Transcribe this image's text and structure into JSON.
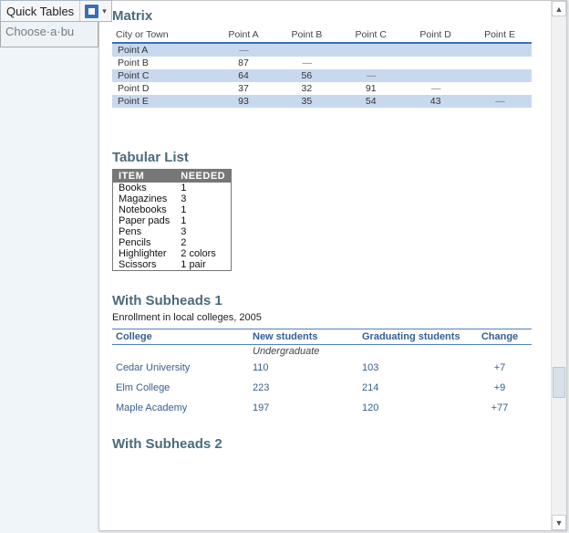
{
  "toolbar": {
    "quick_tables_label": "Quick Tables"
  },
  "doc_placeholder": "Choose·a·bu",
  "sections": {
    "matrix": {
      "title": "Matrix",
      "headers": [
        "City or Town",
        "Point A",
        "Point B",
        "Point C",
        "Point D",
        "Point E"
      ],
      "rows": [
        {
          "label": "Point A",
          "vals": [
            "—",
            "",
            "",
            "",
            ""
          ]
        },
        {
          "label": "Point B",
          "vals": [
            "87",
            "—",
            "",
            "",
            ""
          ]
        },
        {
          "label": "Point C",
          "vals": [
            "64",
            "56",
            "—",
            "",
            ""
          ]
        },
        {
          "label": "Point D",
          "vals": [
            "37",
            "32",
            "91",
            "—",
            ""
          ]
        },
        {
          "label": "Point E",
          "vals": [
            "93",
            "35",
            "54",
            "43",
            "—"
          ]
        }
      ]
    },
    "tabular": {
      "title": "Tabular List",
      "headers": [
        "ITEM",
        "NEEDED"
      ],
      "rows": [
        [
          "Books",
          "1"
        ],
        [
          "Magazines",
          "3"
        ],
        [
          "Notebooks",
          "1"
        ],
        [
          "Paper pads",
          "1"
        ],
        [
          "Pens",
          "3"
        ],
        [
          "Pencils",
          "2"
        ],
        [
          "Highlighter",
          "2 colors"
        ],
        [
          "Scissors",
          "1 pair"
        ]
      ]
    },
    "subheads1": {
      "title": "With Subheads 1",
      "caption": "Enrollment in local colleges, 2005",
      "headers": [
        "College",
        "New students",
        "Graduating students",
        "Change"
      ],
      "subgroup": "Undergraduate",
      "rows": [
        [
          "Cedar University",
          "110",
          "103",
          "+7"
        ],
        [
          "Elm College",
          "223",
          "214",
          "+9"
        ],
        [
          "Maple Academy",
          "197",
          "120",
          "+77"
        ]
      ]
    },
    "subheads2": {
      "title": "With Subheads 2"
    }
  }
}
